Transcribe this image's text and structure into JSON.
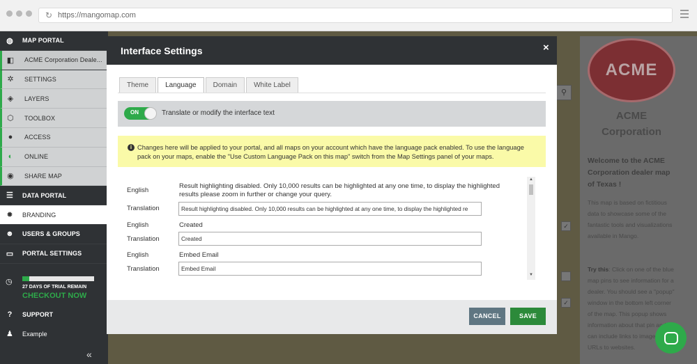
{
  "browser": {
    "url": "https://mangomap.com"
  },
  "sidebar": {
    "items": [
      {
        "label": "MAP PORTAL",
        "icon": "globe-icon"
      },
      {
        "label": "ACME Corporation Deale...",
        "icon": "portal-icon"
      },
      {
        "label": "SETTINGS",
        "icon": "gear-icon"
      },
      {
        "label": "LAYERS",
        "icon": "layers-icon"
      },
      {
        "label": "TOOLBOX",
        "icon": "toolbox-icon"
      },
      {
        "label": "ACCESS",
        "icon": "access-icon"
      },
      {
        "label": "ONLINE",
        "icon": "toggle-icon"
      },
      {
        "label": "SHARE MAP",
        "icon": "share-icon"
      },
      {
        "label": "DATA PORTAL",
        "icon": "database-icon"
      },
      {
        "label": "BRANDING",
        "icon": "branding-icon"
      },
      {
        "label": "USERS & GROUPS",
        "icon": "users-icon"
      },
      {
        "label": "PORTAL SETTINGS",
        "icon": "monitor-icon"
      }
    ],
    "trial": {
      "progress": 0.1,
      "days_label": "27 DAYS OF TRIAL REMAIN",
      "cta": "CHECKOUT NOW"
    },
    "support": "SUPPORT",
    "account": "Example",
    "collapse": "«"
  },
  "background": {
    "logo_text": "ACME",
    "title": "ACME Corporation",
    "welcome": "Welcome to the ACME Corporation dealer map of Texas !",
    "text1": "This map is based on fictitious data to showcase some of the fantastic tools and visualizations available in Mango.",
    "try_label": "Try this",
    "text2": ": Click on one of the blue map pins to see information for a dealer. You should see a \"popup\" window in the bottom left corner of the map. This popup shows information about that pin and can include links to images and URLs to websites."
  },
  "modal": {
    "title": "Interface Settings",
    "close": "×",
    "tabs": [
      "Theme",
      "Language",
      "Domain",
      "White Label"
    ],
    "active_tab": "Language",
    "toggle": {
      "state": "ON",
      "label": "Translate or modify the interface text"
    },
    "notice": "Changes here will be applied to your portal, and all maps on your account which have the language pack enabled. To use the language pack on your maps, enable the \"Use Custom Language Pack on this map\" switch from the Map Settings panel of your maps.",
    "entries": [
      {
        "english_label": "English",
        "english": "Result highlighting disabled. Only 10,000 results can be highlighted at any one time, to display the highlighted results please zoom in further or change your query.",
        "translation_label": "Translation",
        "translation": "Result highlighting disabled. Only 10,000 results can be highlighted at any one time, to display the highlighted re"
      },
      {
        "english_label": "English",
        "english": "Created",
        "translation_label": "Translation",
        "translation": "Created"
      },
      {
        "english_label": "English",
        "english": "Embed Email",
        "translation_label": "Translation",
        "translation": "Embed Email"
      }
    ],
    "buttons": {
      "cancel": "CANCEL",
      "save": "SAVE"
    }
  },
  "colors": {
    "accent": "#2eaa4a",
    "sidebar": "#2f3235",
    "notice": "#fafaa8",
    "cancel": "#5f7682",
    "save": "#2c8a3a"
  }
}
